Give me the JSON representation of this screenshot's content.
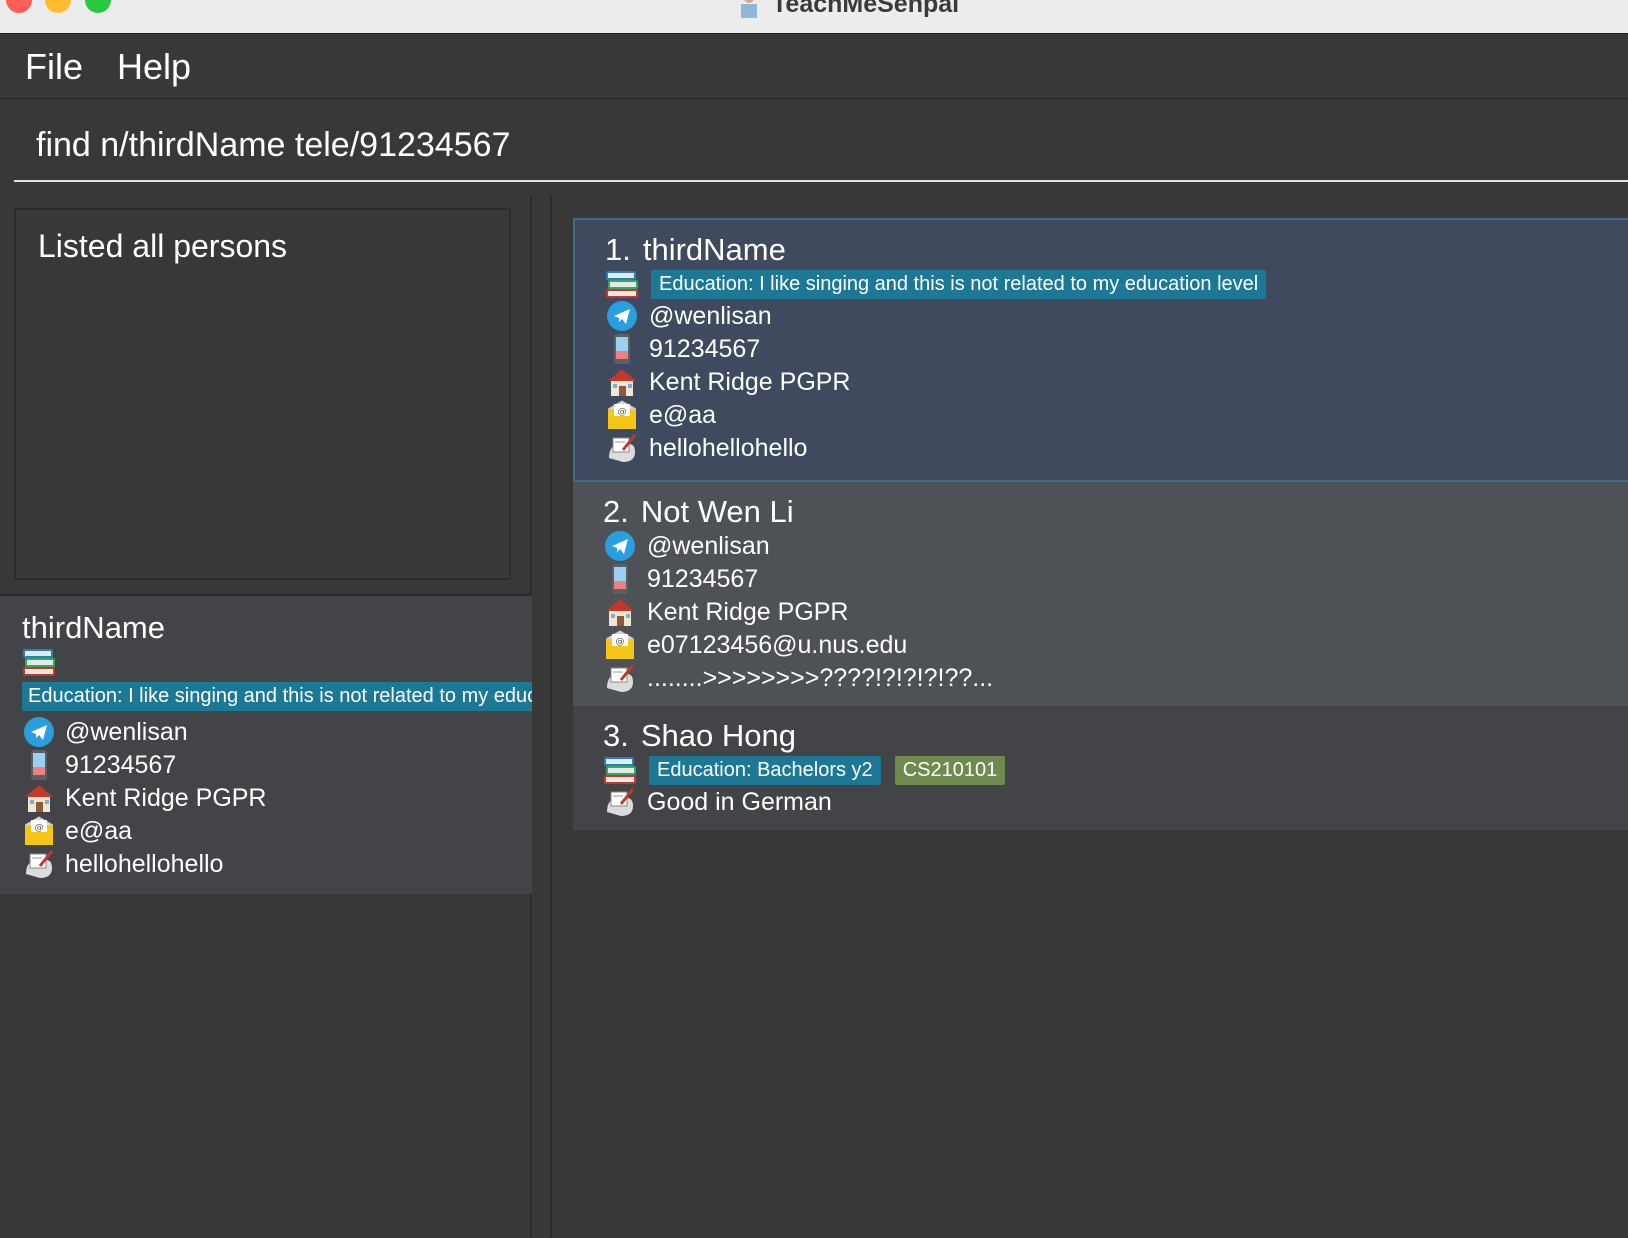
{
  "window": {
    "title": "TeachMeSenpai"
  },
  "menu": {
    "file_label": "File",
    "help_label": "Help"
  },
  "command": {
    "value": "find n/thirdName tele/91234567"
  },
  "result_display": {
    "text": "Listed all persons"
  },
  "detail": {
    "name": "thirdName",
    "education_tag": "Education: I like singing and this is not related to my education level",
    "telegram": "@wenlisan",
    "phone": "91234567",
    "address": "Kent Ridge PGPR",
    "email": "e@aa",
    "remark": "hellohellohello"
  },
  "persons": [
    {
      "index": "1.",
      "name": "thirdName",
      "tags": [
        {
          "text": "Education: I like singing and this is not related to my education level",
          "kind": "education"
        }
      ],
      "telegram": "@wenlisan",
      "phone": "91234567",
      "address": "Kent Ridge PGPR",
      "email": "e@aa",
      "remark": "hellohellohello"
    },
    {
      "index": "2.",
      "name": "Not Wen Li",
      "telegram": "@wenlisan",
      "phone": "91234567",
      "address": "Kent Ridge PGPR",
      "email": "e07123456@u.nus.edu",
      "remark": "........>>>>>>>>????!?!?!?!??..."
    },
    {
      "index": "3.",
      "name": "Shao Hong",
      "tags": [
        {
          "text": "Education: Bachelors y2",
          "kind": "education"
        },
        {
          "text": "CS210101",
          "kind": "module"
        }
      ],
      "remark": "Good in German"
    }
  ],
  "colors": {
    "background": "#383838",
    "selected_card": "#3f4a5e",
    "education_tag": "#1d7895",
    "module_tag": "#6f8a4e"
  }
}
